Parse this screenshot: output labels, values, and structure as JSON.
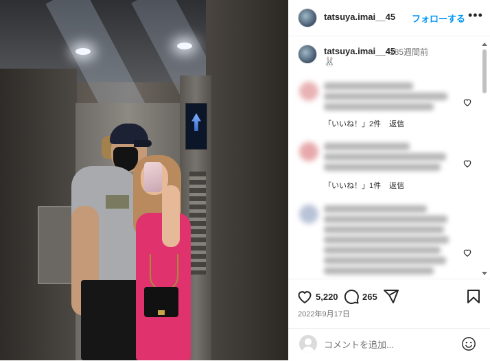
{
  "post": {
    "username": "tatsuya.imai__45",
    "follow_label": "フォローする",
    "more_label": "•••"
  },
  "caption": {
    "username": "tatsuya.imai__45",
    "time": "185週間前",
    "text": "🐰"
  },
  "comments": [
    {
      "likes_label": "「いいね！」2件",
      "reply_label": "返信",
      "avatar_color": "#e9b2b4"
    },
    {
      "likes_label": "「いいね！」1件",
      "reply_label": "返信",
      "avatar_color": "#e7a9ab"
    },
    {
      "likes_label": "",
      "reply_label": "",
      "avatar_color": "#b9c3d8"
    }
  ],
  "actions": {
    "likes_count": "5,220",
    "comments_count": "265",
    "date": "2022年9月17日"
  },
  "comment_box": {
    "placeholder": "コメントを追加..."
  },
  "icons": {
    "like": "heart-icon",
    "comment": "comment-bubble-icon",
    "share": "paper-plane-icon",
    "save": "bookmark-icon",
    "emoji": "smiley-icon"
  }
}
